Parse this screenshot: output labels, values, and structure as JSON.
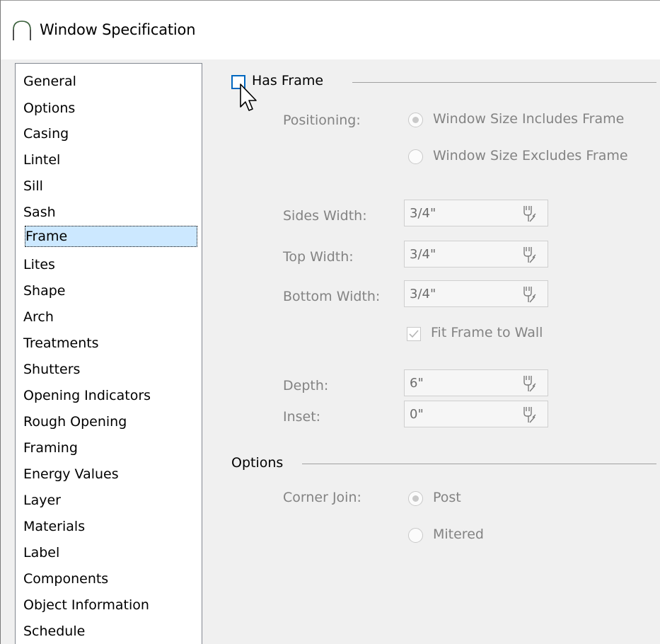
{
  "window": {
    "title": "Window Specification",
    "title_icon": "arch-window-icon"
  },
  "sidebar": {
    "items": [
      {
        "label": "General"
      },
      {
        "label": "Options"
      },
      {
        "label": "Casing"
      },
      {
        "label": "Lintel"
      },
      {
        "label": "Sill"
      },
      {
        "label": "Sash"
      },
      {
        "label": "Frame",
        "selected": true
      },
      {
        "label": "Lites"
      },
      {
        "label": "Shape"
      },
      {
        "label": "Arch"
      },
      {
        "label": "Treatments"
      },
      {
        "label": "Shutters"
      },
      {
        "label": "Opening Indicators"
      },
      {
        "label": "Rough Opening"
      },
      {
        "label": "Framing"
      },
      {
        "label": "Energy Values"
      },
      {
        "label": "Layer"
      },
      {
        "label": "Materials"
      },
      {
        "label": "Label"
      },
      {
        "label": "Components"
      },
      {
        "label": "Object Information"
      },
      {
        "label": "Schedule"
      }
    ]
  },
  "frame": {
    "has_frame_label": "Has Frame",
    "has_frame_checked": false,
    "positioning_label": "Positioning:",
    "positioning_options": [
      {
        "label": "Window Size Includes Frame",
        "selected": true
      },
      {
        "label": "Window Size Excludes Frame",
        "selected": false
      }
    ],
    "sides_width_label": "Sides Width:",
    "sides_width_value": "3/4\"",
    "top_width_label": "Top Width:",
    "top_width_value": "3/4\"",
    "bottom_width_label": "Bottom Width:",
    "bottom_width_value": "3/4\"",
    "fit_frame_label": "Fit Frame to Wall",
    "fit_frame_checked": true,
    "depth_label": "Depth:",
    "depth_value": "6\"",
    "inset_label": "Inset:",
    "inset_value": "0\"",
    "field_icon": "calculator-icon"
  },
  "options": {
    "group_label": "Options",
    "corner_join_label": "Corner Join:",
    "corner_join_options": [
      {
        "label": "Post",
        "selected": true
      },
      {
        "label": "Mitered",
        "selected": false
      }
    ]
  },
  "colors": {
    "accent": "#0067c0",
    "selection_bg": "#cce8ff",
    "disabled_text": "#838383"
  }
}
